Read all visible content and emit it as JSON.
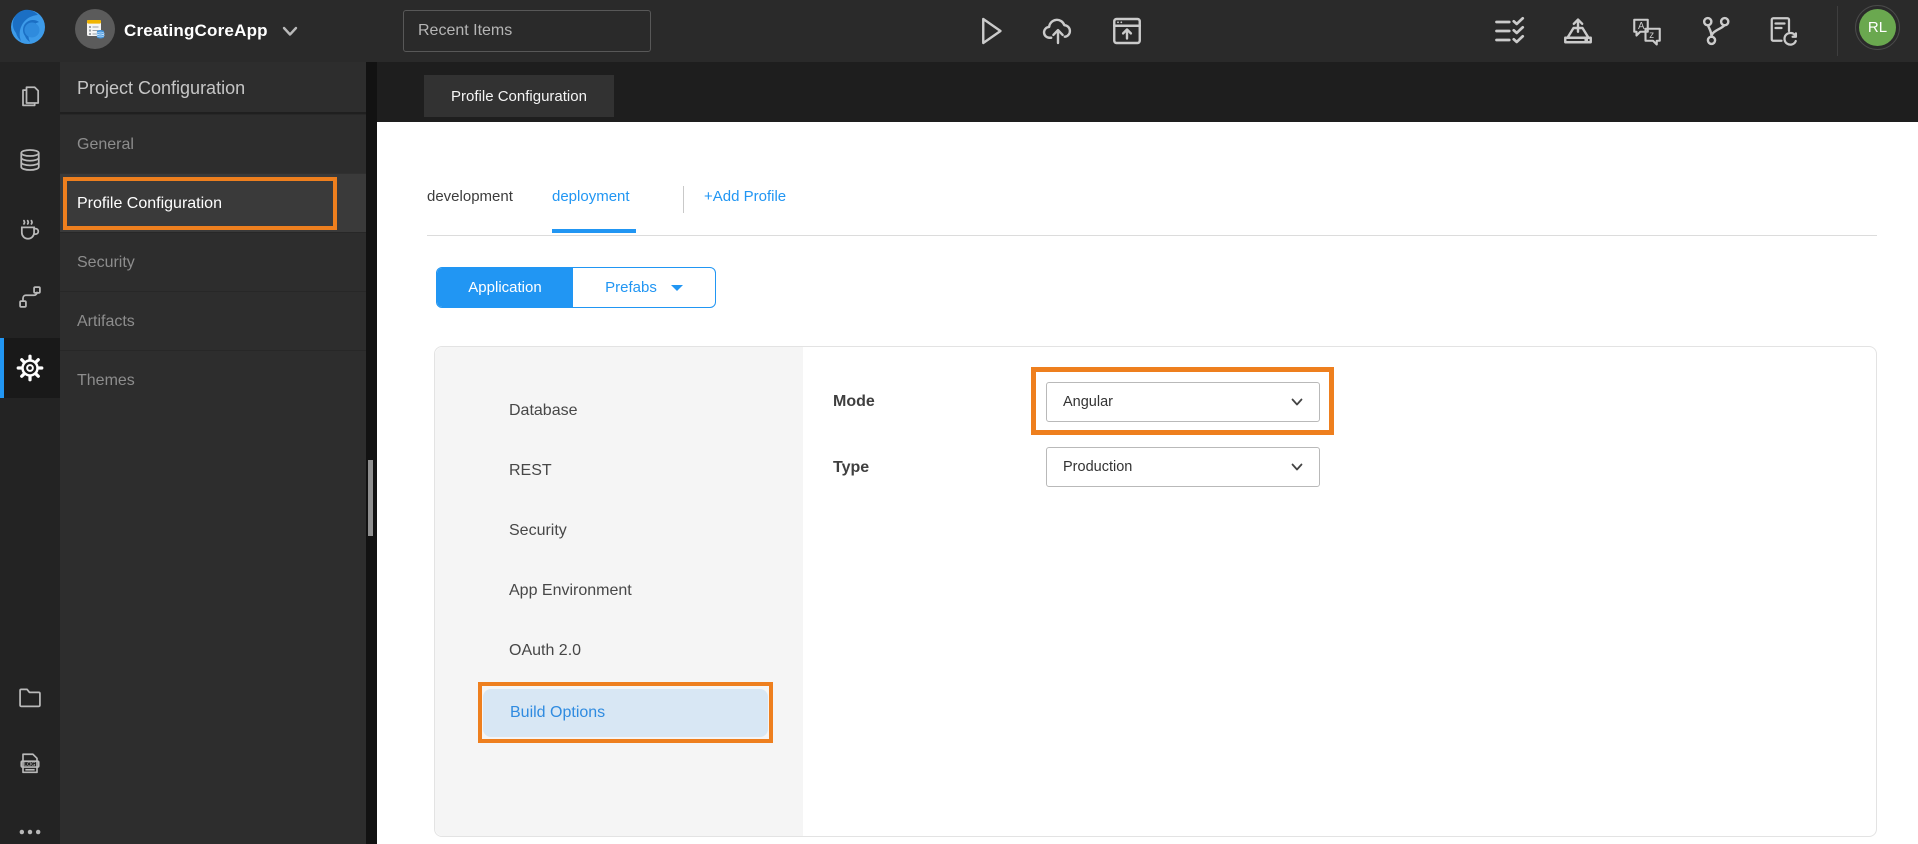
{
  "app": {
    "project_name": "CreatingCoreApp",
    "recent_items_placeholder": "Recent Items",
    "avatar_initials": "RL"
  },
  "colors": {
    "accent_blue": "#2196f3",
    "highlight_orange": "#ee7f1e",
    "topbar_bg": "#2a2a2a",
    "side_panel_bg": "#2d2d2d",
    "band_bg": "#1e1e1e",
    "avatar_green": "#6aa84f",
    "active_section_bg": "#d8e7f4"
  },
  "icons": {
    "topbar_left": [
      "wavemaker-logo",
      "project-icon",
      "chevron-down-icon"
    ],
    "topbar_center": [
      "run-icon",
      "cloud-upload-icon",
      "preview-window-icon"
    ],
    "topbar_right": [
      "checklist-icon",
      "export-icon",
      "translate-icon",
      "version-control-icon",
      "file-sync-icon"
    ],
    "rail": [
      "pages-icon",
      "database-icon",
      "java-services-icon",
      "orchestration-icon",
      "settings-gear-icon",
      "folder-icon",
      "log-file-icon",
      "more-ellipsis-icon"
    ]
  },
  "sidebar": {
    "title": "Project Configuration",
    "items": [
      {
        "label": "General",
        "active": false
      },
      {
        "label": "Profile Configuration",
        "active": true
      },
      {
        "label": "Security",
        "active": false
      },
      {
        "label": "Artifacts",
        "active": false
      },
      {
        "label": "Themes",
        "active": false
      }
    ]
  },
  "main": {
    "tab_title": "Profile Configuration",
    "profile_tabs": {
      "development": "development",
      "deployment": "deployment"
    },
    "active_profile_tab": "deployment",
    "add_profile_label": "+Add Profile",
    "scope_toggle": {
      "application": "Application",
      "prefabs": "Prefabs",
      "active": "Application"
    },
    "config_sections": [
      "Database",
      "REST",
      "Security",
      "App Environment",
      "OAuth 2.0"
    ],
    "active_section": "Build Options",
    "form": {
      "mode_label": "Mode",
      "mode_value": "Angular",
      "type_label": "Type",
      "type_value": "Production"
    }
  }
}
